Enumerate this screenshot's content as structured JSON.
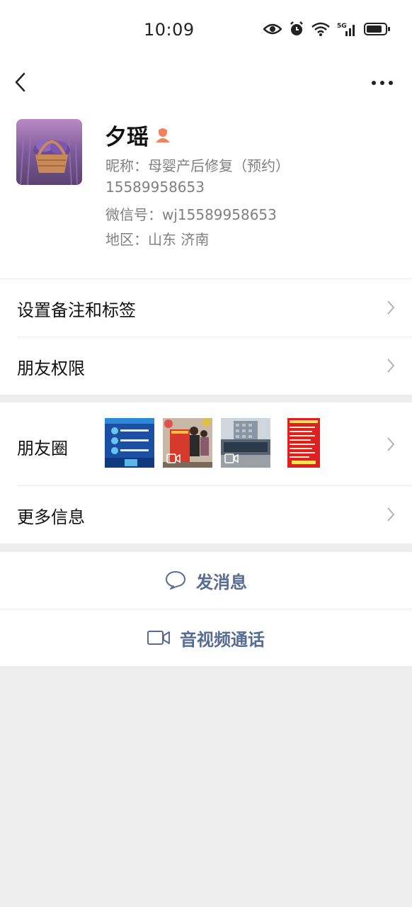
{
  "status_bar": {
    "time": "10:09",
    "icons": [
      "eye-icon",
      "alarm-icon",
      "wifi-icon",
      "signal-5g-icon",
      "battery-icon"
    ]
  },
  "top_bar": {
    "back_icon": "chevron-left-icon",
    "more_icon": "more-dots-icon"
  },
  "profile": {
    "name": "夕瑶",
    "gender_icon": "person-female-icon",
    "nickname": "昵称：母婴产后修复（预约）",
    "phone": "15589958653",
    "wechat_id": "微信号：wj15589958653",
    "region": "地区：山东  济南"
  },
  "settings": [
    {
      "label": "设置备注和标签"
    },
    {
      "label": "朋友权限"
    }
  ],
  "moments": {
    "label": "朋友圈",
    "thumbnails": [
      {
        "kind": "image",
        "theme": "blue-poster"
      },
      {
        "kind": "video",
        "theme": "banner-photo"
      },
      {
        "kind": "video",
        "theme": "building"
      },
      {
        "kind": "image",
        "theme": "red-poster"
      }
    ]
  },
  "more_info": {
    "label": "更多信息"
  },
  "actions": {
    "message": "发消息",
    "call": "音视频通话"
  },
  "colors": {
    "link_blue": "#576b95",
    "gender_orange": "#f2825a",
    "background": "#ededed"
  }
}
